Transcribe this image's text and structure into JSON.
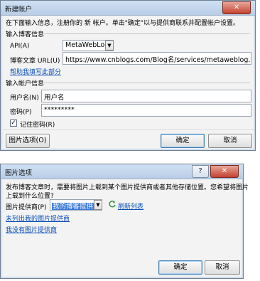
{
  "dialog1": {
    "title": "新建帐户",
    "close_glyph": "✕",
    "intro": "在下面输入信息，注册你的 新 帐户。单击\"确定\"以与提供商联系并配置帐户设置。",
    "section_blog": "输入博客信息",
    "api_label": "API(A)",
    "api_value": "MetaWebLog",
    "url_label": "博客文章 URL(U)",
    "url_value": "https://www.cnblogs.com/Blog名/services/metaweblog.aspx",
    "help_link": "帮助我填写此部分",
    "section_account": "输入帐户信息",
    "username_label": "用户名(N)",
    "username_value": "用户名",
    "password_label": "密码(P)",
    "password_value": "*********",
    "remember_label": "记住密码(R)",
    "remember_checked": true,
    "picture_options_button": "图片选项(O)",
    "ok_button": "确定",
    "cancel_button": "取消"
  },
  "dialog2": {
    "title": "图片选项",
    "help_glyph": "?",
    "close_glyph": "✕",
    "intro_line1": "发布博客文章时，需要将图片上载到某个图片提供商或者其他存储位置。您希望将图片",
    "intro_line2": "上载到什么位置?",
    "provider_label": "图片提供商(P)",
    "provider_value": "我的博客提供商",
    "refresh_link": "刷新列表",
    "not_listed_link": "未列出我的图片提供商",
    "no_provider_link": "我没有图片提供商",
    "ok_button": "确定",
    "cancel_button": "取消"
  }
}
